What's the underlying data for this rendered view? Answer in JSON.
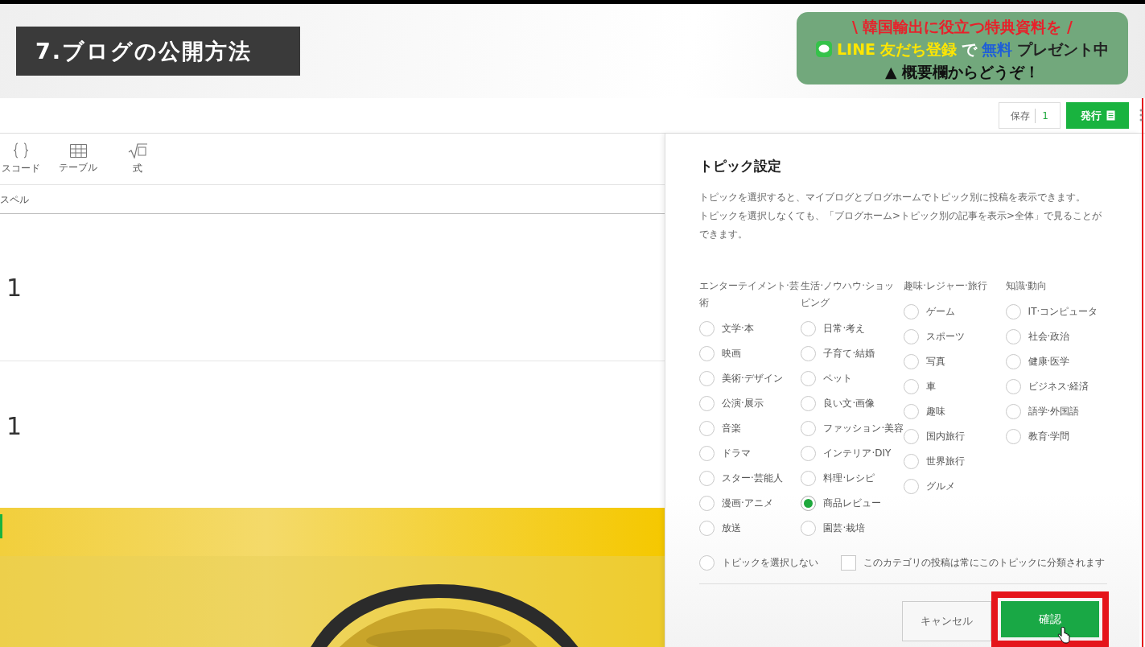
{
  "header": {
    "title": "7.ブログの公開方法"
  },
  "promo": {
    "lines": [
      [
        {
          "text": "\\ 韓国輸出に役立つ特典資料を /",
          "color": "#e8202a"
        }
      ],
      [
        {
          "text": "LINE",
          "color": "#ffe600"
        },
        {
          "text": "友だち登録",
          "color": "#ffe600"
        },
        {
          "text": "で",
          "color": "#ffffff"
        },
        {
          "text": "無料",
          "color": "#1f5fd8"
        },
        {
          "text": "プレゼント中",
          "color": "#222222"
        }
      ],
      [
        {
          "text": "▲ 概要欄からどうぞ！",
          "color": "#111111"
        }
      ]
    ]
  },
  "topbar": {
    "save_label": "保存",
    "save_count": "1",
    "publish_label": "発行"
  },
  "tools": [
    {
      "kind": "code",
      "label": "スコード"
    },
    {
      "kind": "table",
      "label": "テーブル"
    },
    {
      "kind": "formula",
      "label": "式"
    }
  ],
  "spell_label": "スペル",
  "editor_lines": [
    "1",
    "1"
  ],
  "dialog": {
    "title": "トピック設定",
    "description": [
      "トピックを選択すると、マイブログとブログホームでトピック別に投稿を表示できます。",
      "トピックを選択しなくても、「ブログホーム>トピック別の記事を表示>全体」で見ることができます。"
    ],
    "categories": [
      {
        "heading": "エンターテイメント·芸術",
        "topics": [
          {
            "label": "文学·本",
            "selected": false
          },
          {
            "label": "映画",
            "selected": false
          },
          {
            "label": "美術·デザイン",
            "selected": false
          },
          {
            "label": "公演·展示",
            "selected": false
          },
          {
            "label": "音楽",
            "selected": false
          },
          {
            "label": "ドラマ",
            "selected": false
          },
          {
            "label": "スター·芸能人",
            "selected": false
          },
          {
            "label": "漫画·アニメ",
            "selected": false
          },
          {
            "label": "放送",
            "selected": false
          }
        ]
      },
      {
        "heading": "生活·ノウハウ·ショッピング",
        "topics": [
          {
            "label": "日常·考え",
            "selected": false
          },
          {
            "label": "子育て·結婚",
            "selected": false
          },
          {
            "label": "ペット",
            "selected": false
          },
          {
            "label": "良い文·画像",
            "selected": false
          },
          {
            "label": "ファッション·美容",
            "selected": false
          },
          {
            "label": "インテリア·DIY",
            "selected": false
          },
          {
            "label": "料理·レシピ",
            "selected": false
          },
          {
            "label": "商品レビュー",
            "selected": true
          },
          {
            "label": "園芸·栽培",
            "selected": false
          }
        ]
      },
      {
        "heading": "趣味·レジャー·旅行",
        "topics": [
          {
            "label": "ゲーム",
            "selected": false
          },
          {
            "label": "スポーツ",
            "selected": false
          },
          {
            "label": "写真",
            "selected": false
          },
          {
            "label": "車",
            "selected": false
          },
          {
            "label": "趣味",
            "selected": false
          },
          {
            "label": "国内旅行",
            "selected": false
          },
          {
            "label": "世界旅行",
            "selected": false
          },
          {
            "label": "グルメ",
            "selected": false
          }
        ]
      },
      {
        "heading": "知識·動向",
        "topics": [
          {
            "label": "IT·コンピュータ",
            "selected": false
          },
          {
            "label": "社会·政治",
            "selected": false
          },
          {
            "label": "健康·医学",
            "selected": false
          },
          {
            "label": "ビジネス·経済",
            "selected": false
          },
          {
            "label": "語学·外国語",
            "selected": false
          },
          {
            "label": "教育·学問",
            "selected": false
          }
        ]
      }
    ],
    "none_option": {
      "label": "トピックを選択しない",
      "selected": false
    },
    "fixed_option": {
      "label": "このカテゴリの投稿は常にこのトピックに分類されます",
      "checked": false
    },
    "buttons": [
      {
        "kind": "cancel",
        "label": "キャンセル",
        "highlighted": false
      },
      {
        "kind": "confirm",
        "label": "確認",
        "highlighted": true
      }
    ]
  }
}
